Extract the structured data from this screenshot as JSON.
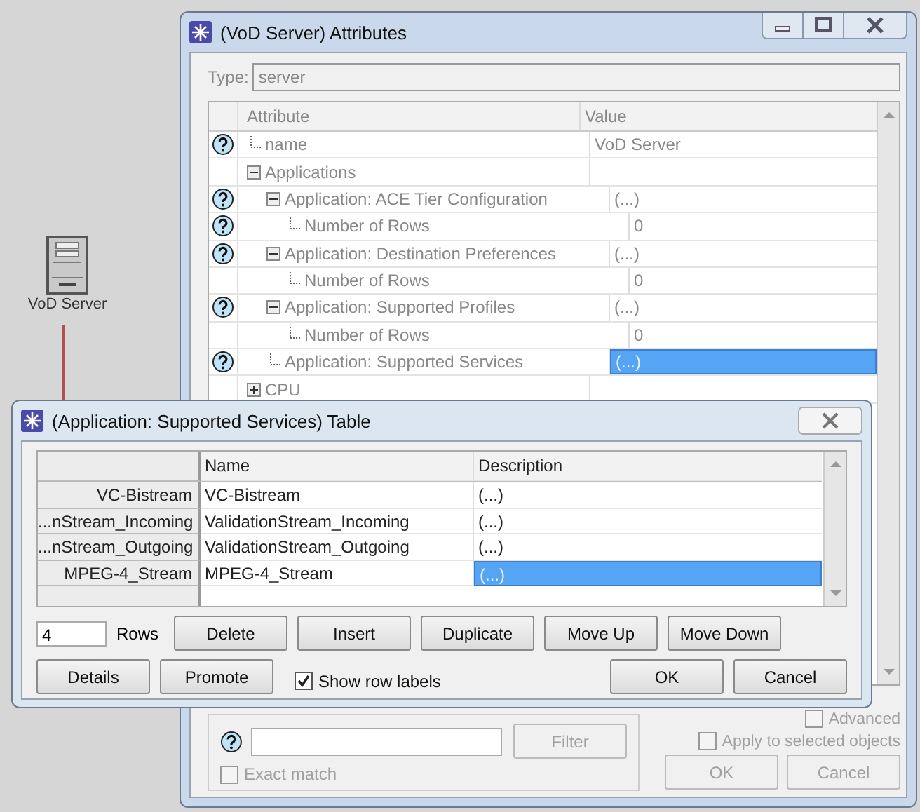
{
  "canvas": {
    "node": {
      "label": "VoD Server"
    }
  },
  "attributes": {
    "title": "(VoD Server) Attributes",
    "type_label": "Type:",
    "type_value": "server",
    "columns": [
      "Attribute",
      "Value"
    ],
    "rows": [
      {
        "label": "name",
        "value": "VoD Server",
        "help": true,
        "selected": false
      },
      {
        "label": "Applications",
        "help": false,
        "expanded": true,
        "selected": false,
        "children": [
          {
            "label": "Application: ACE Tier Configuration",
            "value": "(...)",
            "help": true,
            "expanded": true,
            "selected": false,
            "children": [
              {
                "label": "Number of Rows",
                "value": "0",
                "help": true,
                "selected": false
              }
            ]
          },
          {
            "label": "Application: Destination Preferences",
            "value": "(...)",
            "help": true,
            "expanded": true,
            "selected": false,
            "children": [
              {
                "label": "Number of Rows",
                "value": "0",
                "help": false,
                "selected": false
              }
            ]
          },
          {
            "label": "Application: Supported Profiles",
            "value": "(...)",
            "help": true,
            "expanded": true,
            "selected": false,
            "children": [
              {
                "label": "Number of Rows",
                "value": "0",
                "help": false,
                "selected": false
              }
            ]
          },
          {
            "label": "Application: Supported Services",
            "value": "(...)",
            "help": true,
            "selected": true
          }
        ]
      },
      {
        "label": "CPU",
        "help": false,
        "expanded": false,
        "selected": false
      }
    ],
    "advanced": {
      "label": "Advanced",
      "checked": false
    },
    "filter_button": {
      "label": "Filter",
      "disabled": true
    },
    "exact_match": {
      "label": "Exact match",
      "checked": false
    },
    "apply_selected": {
      "label": "Apply to selected objects",
      "checked": false
    },
    "buttons": [
      {
        "label": "OK",
        "disabled": true
      },
      {
        "label": "Cancel",
        "disabled": true
      }
    ]
  },
  "table_dialog": {
    "title": "(Application: Supported Services) Table",
    "columns": [
      "Name",
      "Description"
    ],
    "rows": [
      {
        "label": "VC-Bistream",
        "name": "VC-Bistream",
        "description": "(...)",
        "selected": false
      },
      {
        "label": "...nStream_Incoming",
        "name": "ValidationStream_Incoming",
        "description": "(...)",
        "selected": false
      },
      {
        "label": "...nStream_Outgoing",
        "name": "ValidationStream_Outgoing",
        "description": "(...)",
        "selected": false
      },
      {
        "label": "MPEG-4_Stream",
        "name": "MPEG-4_Stream",
        "description": "(...)",
        "selected": true
      }
    ],
    "rows_count": "4",
    "rows_label": "Rows",
    "row_buttons": [
      "Delete",
      "Insert",
      "Duplicate",
      "Move Up",
      "Move Down"
    ],
    "left_buttons": [
      "Details",
      "Promote"
    ],
    "show_row_labels": {
      "label": "Show row labels",
      "checked": true
    },
    "buttons": [
      "OK",
      "Cancel"
    ]
  }
}
